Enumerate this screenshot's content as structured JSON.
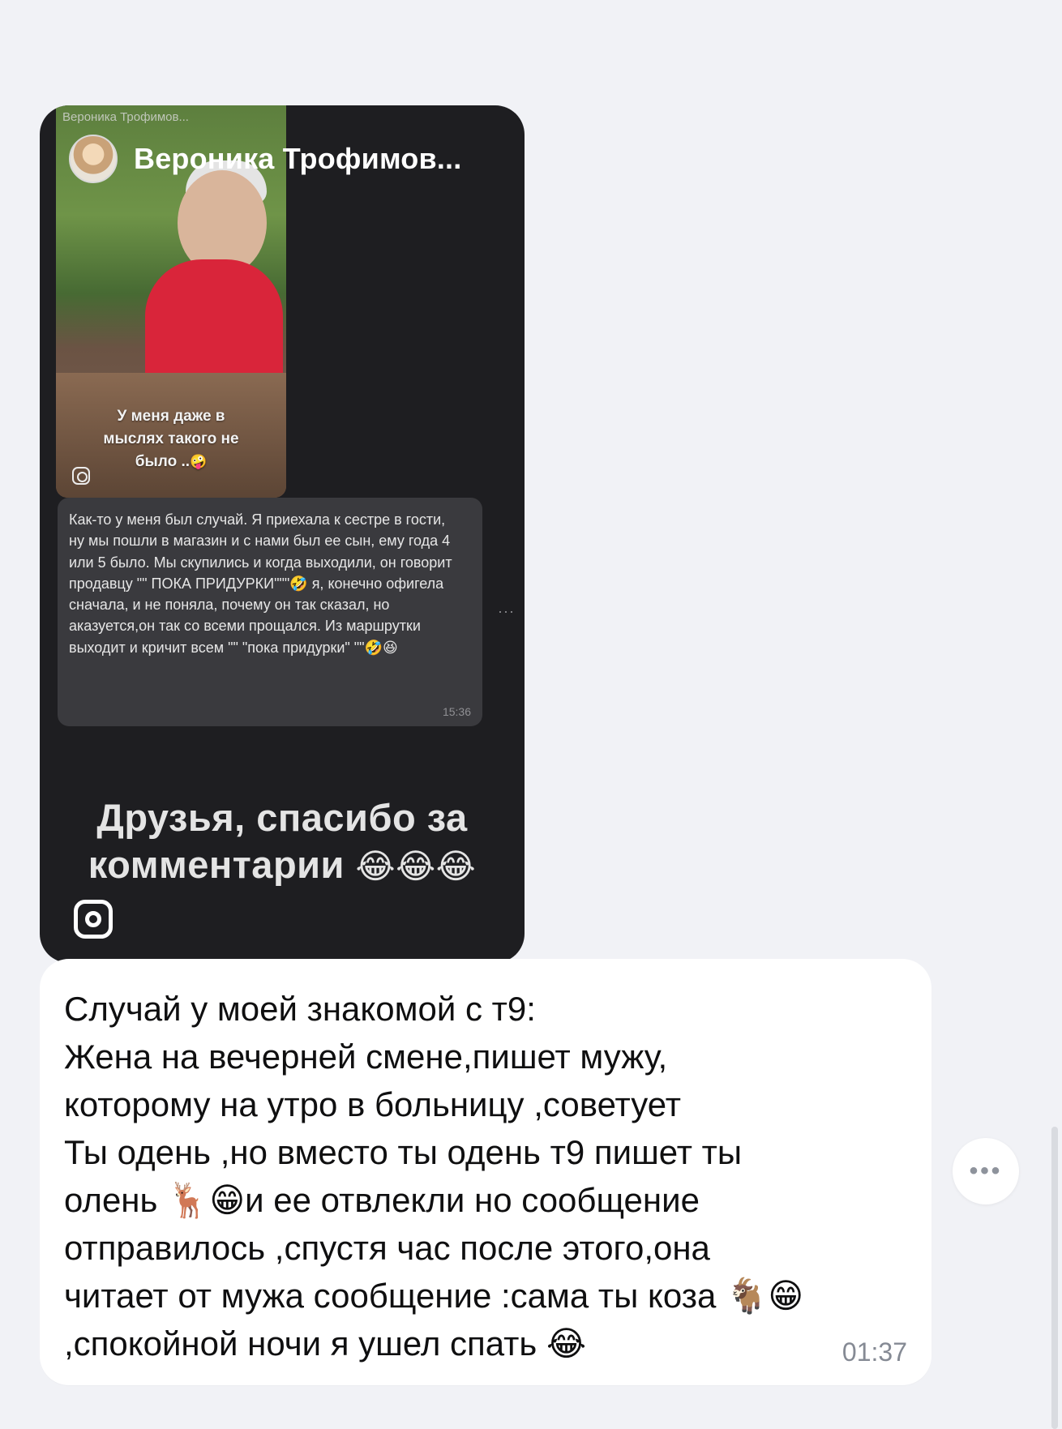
{
  "story": {
    "author_name": "Вероника Трофимов...",
    "inner_topline": "Вероника Трофимов...",
    "photo_caption_line1": "У меня даже в",
    "photo_caption_line2": "мыслях такого не",
    "photo_caption_line3": "было ..",
    "photo_caption_emoji": "🤪",
    "comment_text": "Как-то у меня был случай. Я приехала к сестре в гости, ну мы пошли в магазин и с нами был ее сын, ему года 4 или 5 было. Мы скупились и когда выходили, он говорит продавцу \"\" ПОКА ПРИДУРКИ\"\"\"🤣 я, конечно офигела сначала, и не поняла, почему он так сказал, но аказуется,он так со всеми прощался. Из маршрутки выходит и кричит всем \"\" \"пока придурки\" \"\"🤣😆",
    "comment_time": "15:36",
    "comment_more": "···",
    "caption_line1": "Друзья, спасибо за",
    "caption_line2": "комментарии",
    "caption_emoji": "😂😂😂",
    "icons": [
      "instagram-icon",
      "avatar"
    ]
  },
  "message": {
    "text": "Случай у моей знакомой с т9:\nЖена на вечерней смене,пишет мужу,\nкоторому на утро в больницу ,советует\nТы одень ,но вместо ты одень т9 пишет ты\nолень 🦌😁и ее отвлекли но сообщение\nотправилось ,спустя час после этого,она\nчитает от мужа сообщение :сама ты коза 🐐😁\n,спокойной ночи я ушел спать 😂",
    "time": "01:37"
  },
  "actions": {
    "more_label": "•••"
  },
  "colors": {
    "background": "#f1f2f6",
    "story_bg": "#1e1e21",
    "bubble_bg": "#ffffff",
    "time_gray": "#858a94"
  }
}
